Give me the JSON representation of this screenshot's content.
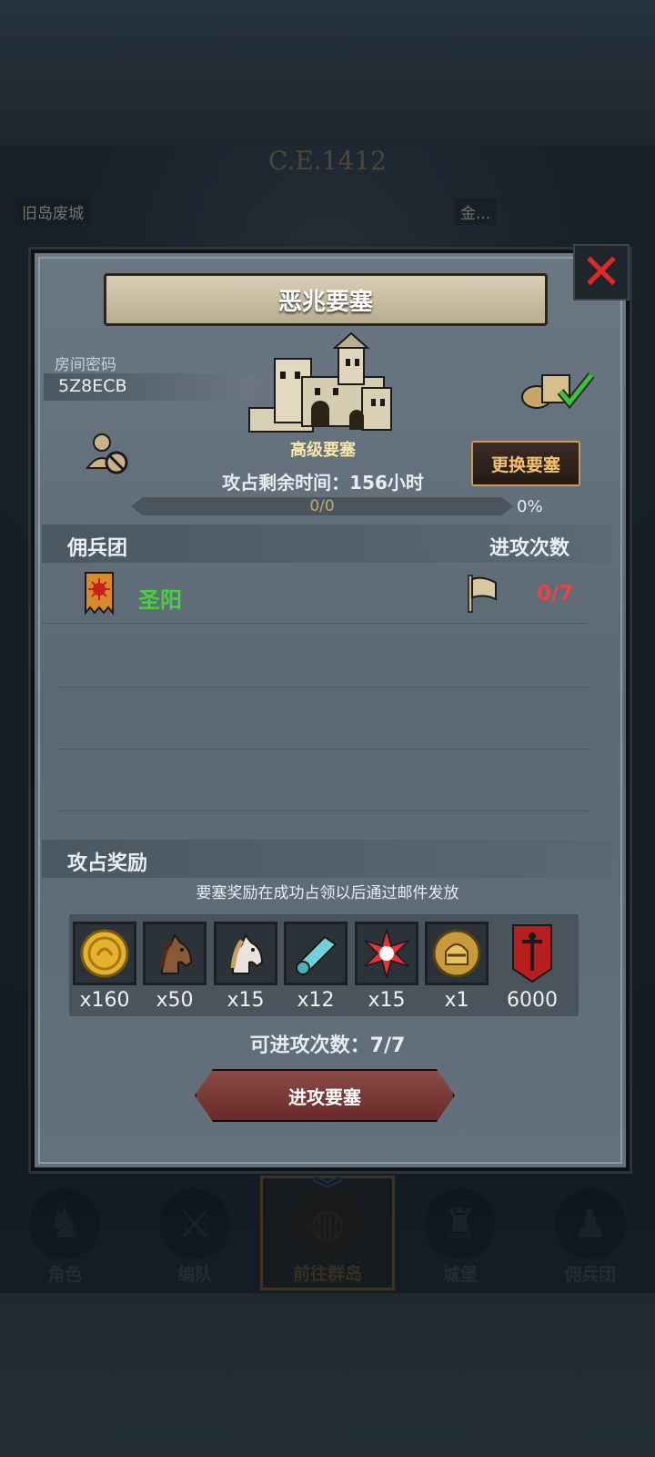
{
  "map": {
    "era": "C.E.1412",
    "loc_left": "旧岛废城",
    "loc_right": "金..."
  },
  "dialog": {
    "title": "恶兆要塞",
    "room_code_label": "房间密码",
    "room_code": "5Z8ECB",
    "fortress_type": "高级要塞",
    "change_button": "更换要塞",
    "time_left": "攻占剩余时间：156小时",
    "progress_text": "0/0",
    "progress_pct": "0%",
    "progress_value": 0,
    "mercenary_header": "佣兵团",
    "attacks_header": "进攻次数",
    "mercenaries": [
      {
        "name": "圣阳",
        "attacks": "0/7"
      }
    ],
    "reward_header": "攻占奖励",
    "reward_note": "要塞奖励在成功占领以后通过邮件发放",
    "rewards": [
      {
        "icon": "gold-coin-icon",
        "qty": "x160"
      },
      {
        "icon": "brown-horse-icon",
        "qty": "x50"
      },
      {
        "icon": "white-horse-icon",
        "qty": "x15"
      },
      {
        "icon": "cloth-roll-icon",
        "qty": "x12"
      },
      {
        "icon": "red-star-gem-icon",
        "qty": "x15"
      },
      {
        "icon": "helmet-medal-icon",
        "qty": "x1"
      },
      {
        "icon": "sword-banner-icon",
        "qty": "6000"
      }
    ],
    "available_attacks": "可进攻次数：7/7",
    "attack_button": "进攻要塞"
  },
  "nav": {
    "items": [
      {
        "label": "角色",
        "icon": "knight-icon"
      },
      {
        "label": "编队",
        "icon": "formation-icon"
      },
      {
        "label": "前往群岛",
        "icon": "globe-icon"
      },
      {
        "label": "城堡",
        "icon": "castle-icon"
      },
      {
        "label": "佣兵团",
        "icon": "mercenary-icon"
      }
    ]
  },
  "colors": {
    "merc_name": "#48d044",
    "attack_count": "#e64646",
    "change_button_text": "#f5c070",
    "close_x": "#e02626"
  }
}
